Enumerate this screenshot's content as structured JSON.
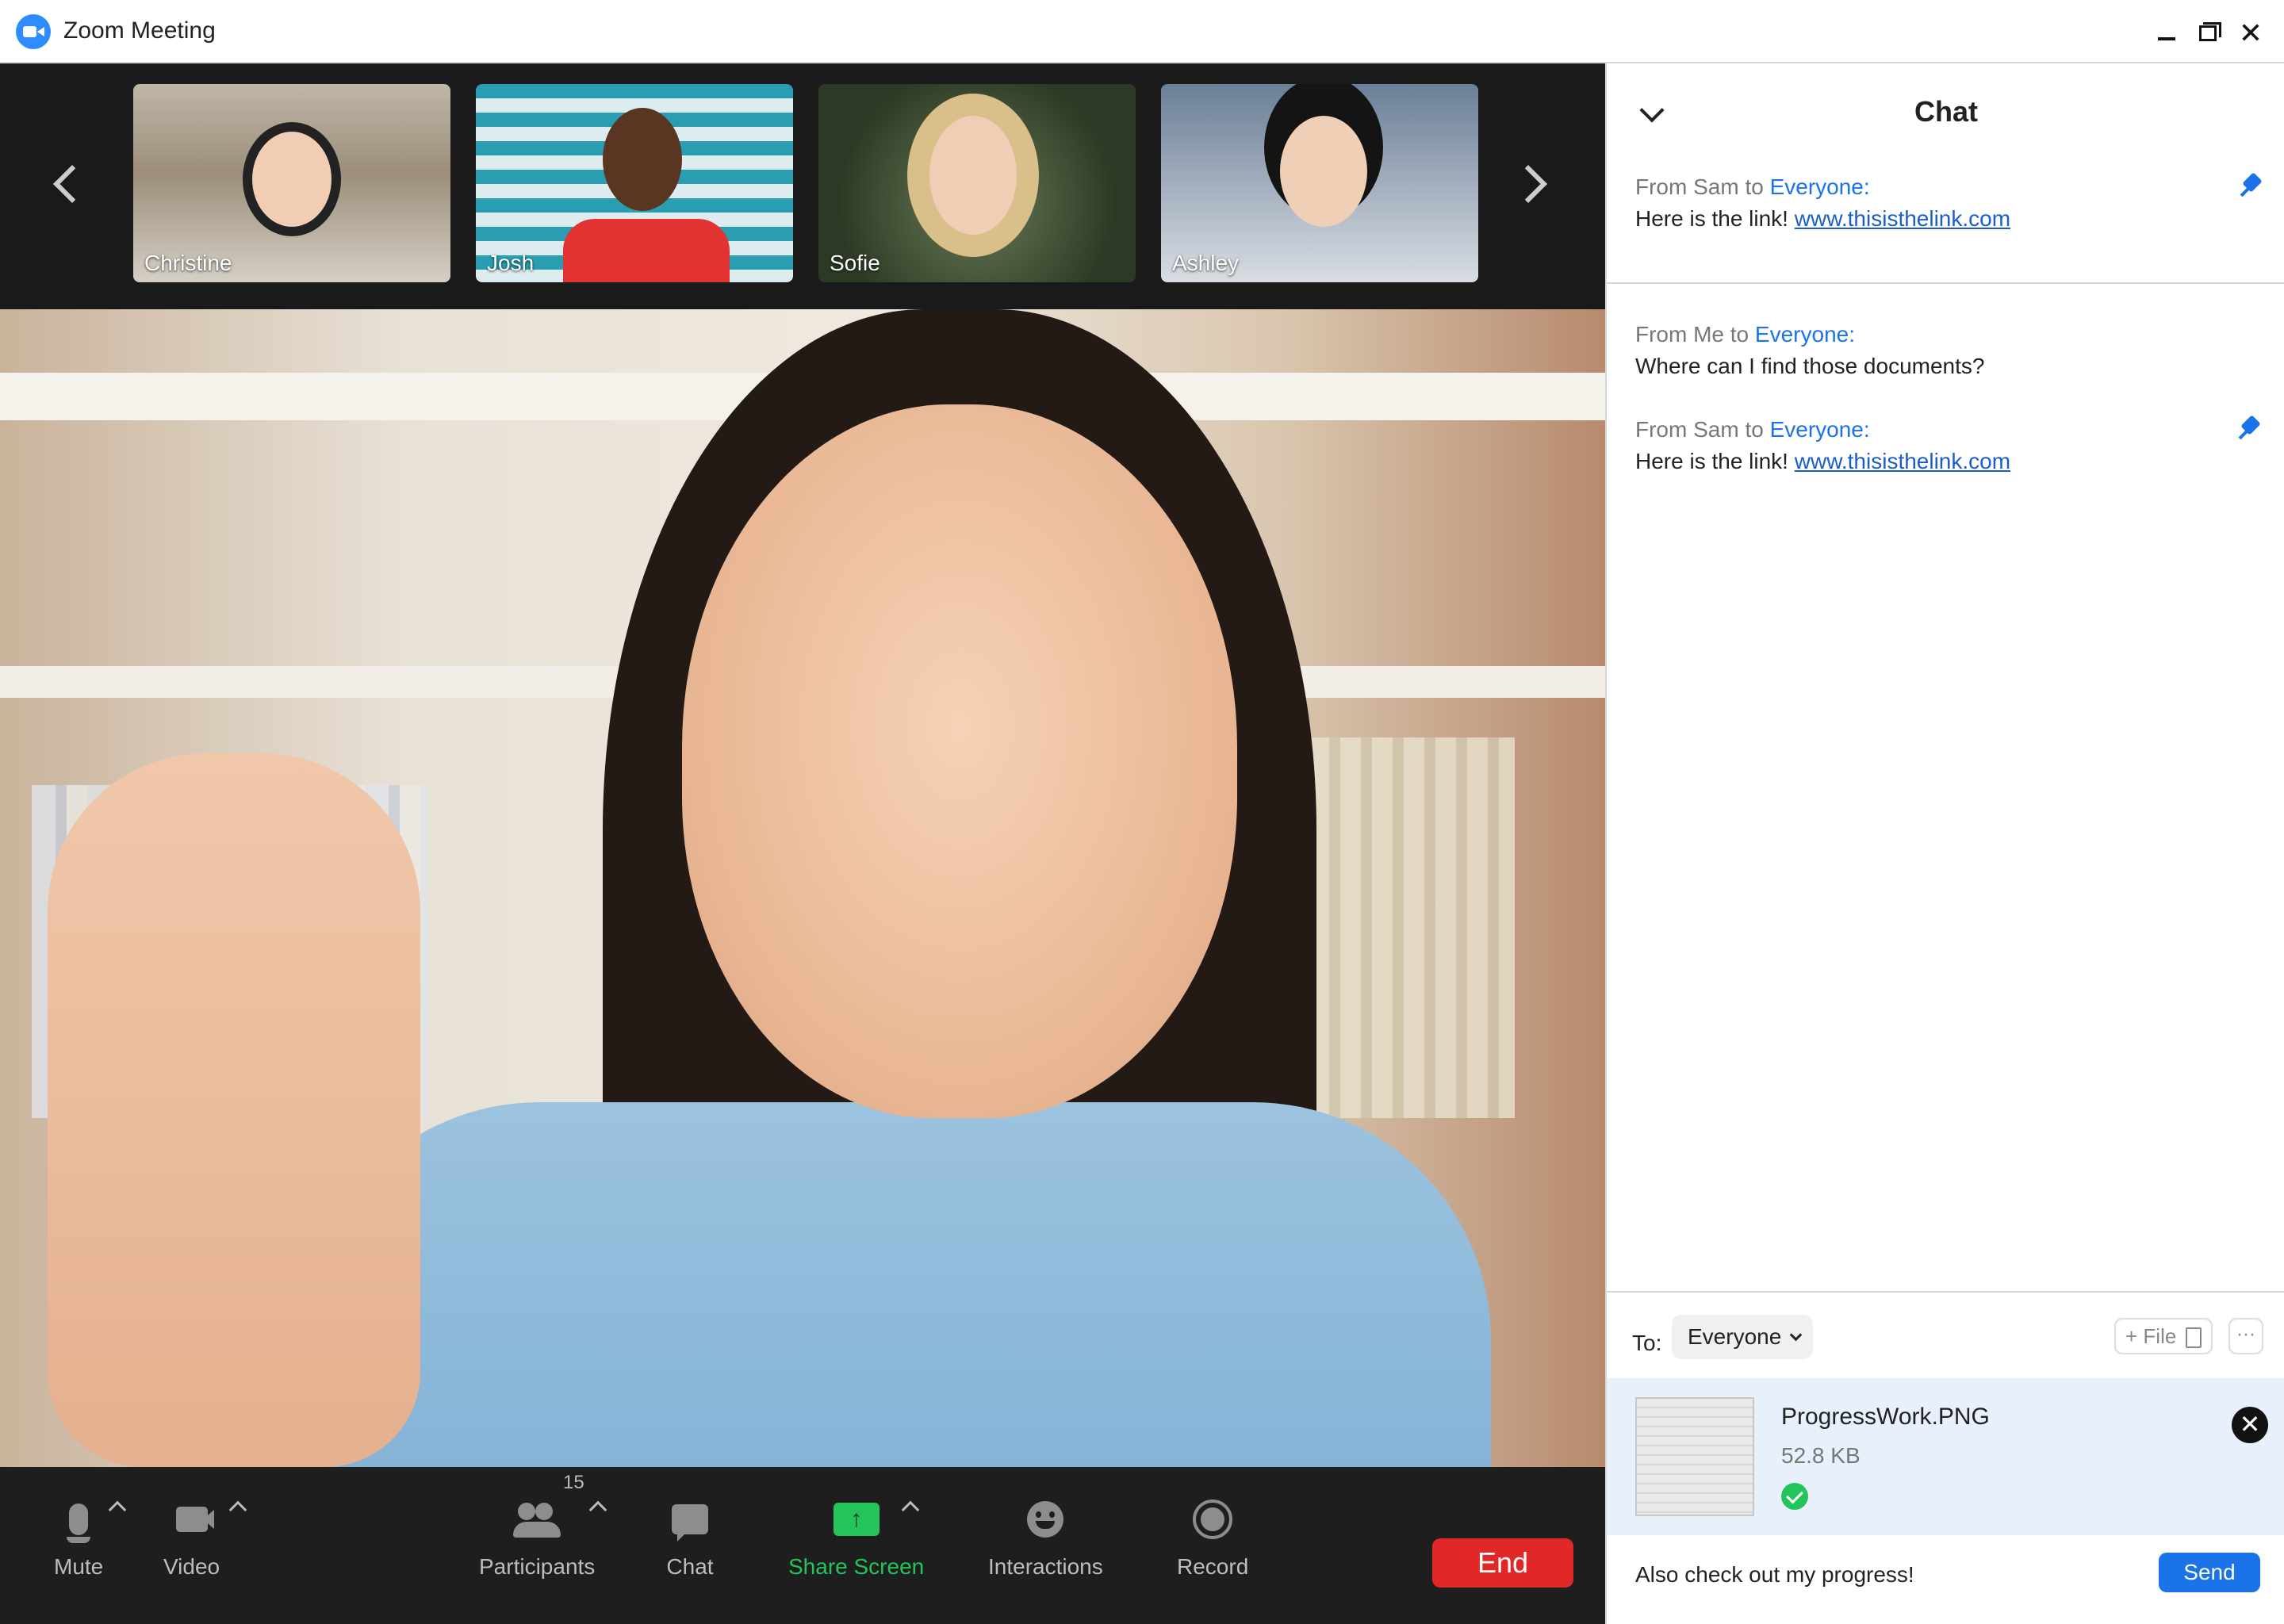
{
  "window": {
    "title": "Zoom Meeting"
  },
  "gallery": {
    "participants": [
      {
        "name": "Christine"
      },
      {
        "name": "Josh"
      },
      {
        "name": "Sofie"
      },
      {
        "name": "Ashley"
      }
    ]
  },
  "toolbar": {
    "mute_label": "Mute",
    "video_label": "Video",
    "participants_label": "Participants",
    "participants_count": "15",
    "chat_label": "Chat",
    "share_label": "Share Screen",
    "interactions_label": "Interactions",
    "record_label": "Record",
    "end_label": "End"
  },
  "chat": {
    "title": "Chat",
    "pinned": {
      "from": "From Sam to",
      "to": "Everyone:",
      "text": "Here is the link!",
      "link": "www.thisisthelink.com"
    },
    "messages": [
      {
        "from": "From Me to",
        "to": "Everyone:",
        "text": "Where can I find those documents?",
        "link": ""
      },
      {
        "from": "From Sam to",
        "to": "Everyone:",
        "text": "Here is the link!",
        "link": "www.thisisthelink.com"
      }
    ],
    "compose": {
      "to_label": "To:",
      "to_value": "Everyone",
      "file_label": "+ File",
      "more_label": "···",
      "attachment": {
        "name": "ProgressWork.PNG",
        "size": "52.8 KB"
      },
      "message": "Also check out my progress!",
      "send_label": "Send"
    }
  },
  "colors": {
    "accent": "#1a73e8",
    "share_green": "#23c45a",
    "end_red": "#e02828",
    "toolbar_bg": "#1e1e1e"
  },
  "icons": [
    "zoom-logo-icon",
    "minimize-icon",
    "maximize-icon",
    "close-icon",
    "chevron-left-icon",
    "chevron-right-icon",
    "microphone-icon",
    "camera-icon",
    "participants-icon",
    "chat-bubble-icon",
    "share-screen-icon",
    "interactions-emoji-icon",
    "record-icon",
    "chevron-down-icon",
    "pin-icon",
    "file-icon",
    "check-icon",
    "remove-icon"
  ]
}
